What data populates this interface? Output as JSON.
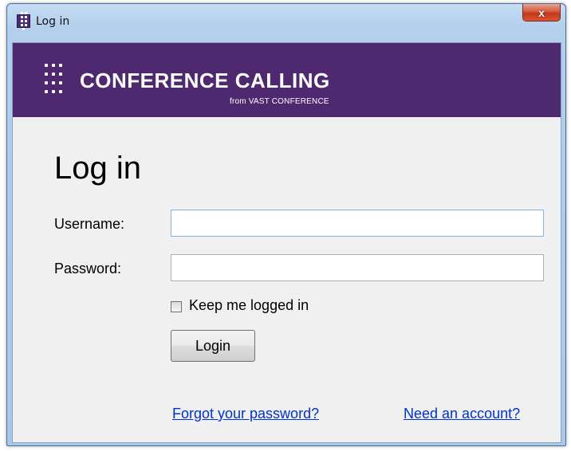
{
  "window": {
    "title": "Log in",
    "close_glyph": "x"
  },
  "icons": {
    "app": "app-grid-icon",
    "close": "close-icon",
    "logo": "dot-grid-logo-icon"
  },
  "banner": {
    "brand": "CONFERENCE CALLING",
    "subtitle": "from VAST CONFERENCE",
    "background": "#4f2970"
  },
  "form": {
    "heading": "Log in",
    "username_label": "Username:",
    "username_value": "",
    "password_label": "Password:",
    "password_value": "",
    "keep_logged_in_label": "Keep me logged in",
    "keep_logged_in_checked": false,
    "login_button": "Login"
  },
  "links": {
    "forgot_password": "Forgot your password?",
    "need_account": "Need an account?",
    "color": "#0033cc"
  }
}
